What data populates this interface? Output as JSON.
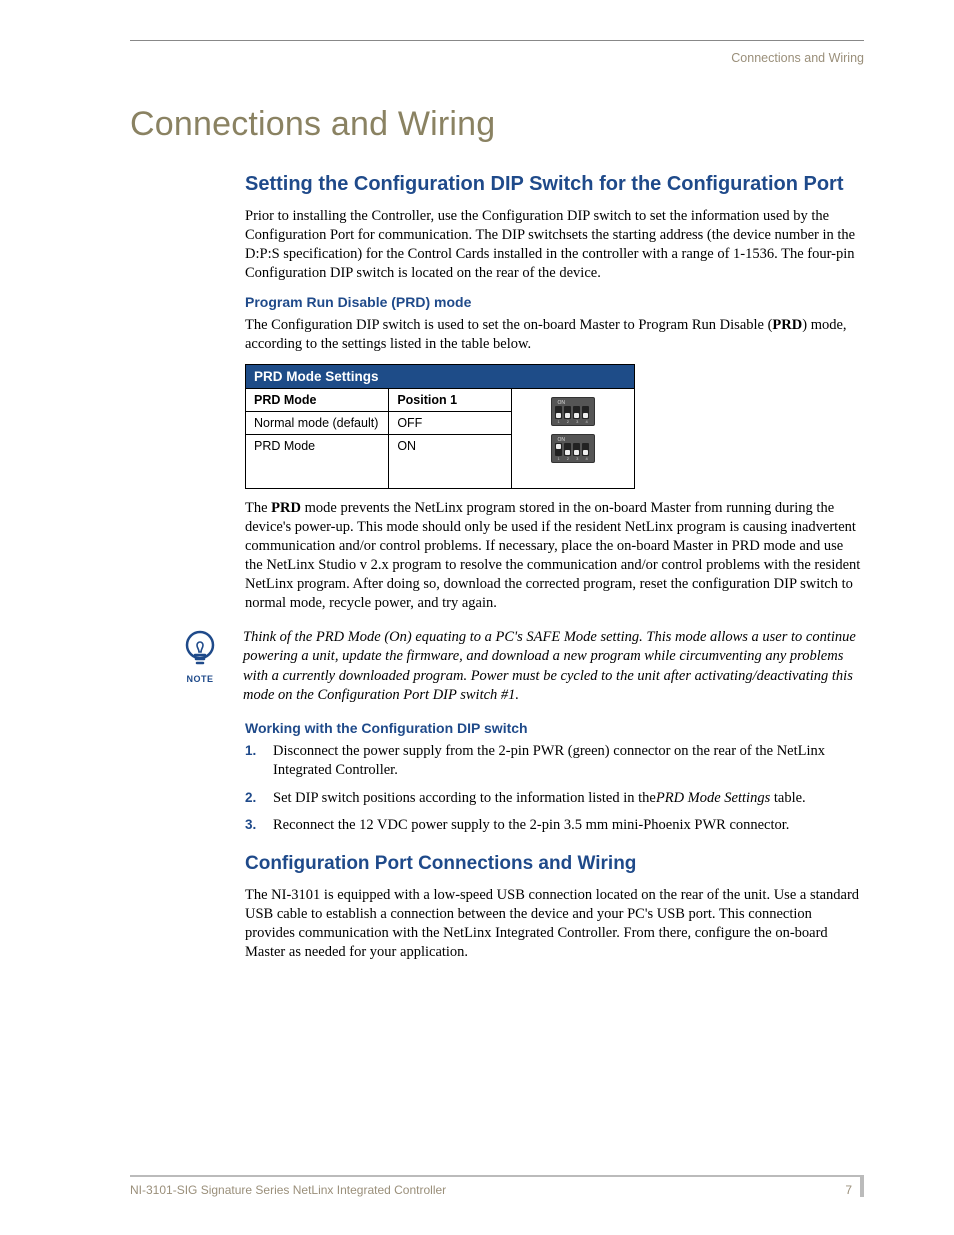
{
  "header": {
    "running_head": "Connections and Wiring"
  },
  "h1": "Connections and Wiring",
  "section1": {
    "title": "Setting the Configuration DIP Switch for the Configuration Port",
    "intro": "Prior to installing the Controller, use the Configuration DIP switch to set the information used by the Configuration Port for communication. The DIP switchsets the starting address (the device number in the D:P:S specification) for the Control Cards installed in the controller with a range of 1-1536. The four-pin Configuration DIP switch is located on the rear of the device.",
    "sub1": {
      "title": "Program Run Disable (PRD) mode",
      "p1_a": "The Configuration DIP switch is used to set the on-board Master to Program Run Disable (",
      "p1_b": "PRD",
      "p1_c": ") mode, according to the settings listed in the table below.",
      "table": {
        "title": "PRD Mode Settings",
        "col1": "PRD Mode",
        "col2": "Position 1",
        "r1c1": "Normal mode (default)",
        "r1c2": "OFF",
        "r2c1": "PRD Mode",
        "r2c2": "ON"
      },
      "p2_a": "The ",
      "p2_b": "PRD",
      "p2_c": " mode prevents the NetLinx program stored in the on-board Master from running during the device's power-up. This mode should only be used if the resident NetLinx program is causing inadvertent communication and/or control problems. If necessary, place the on-board Master in PRD mode and use the NetLinx Studio v 2.x program to resolve the communication and/or control problems with the resident NetLinx program. After doing so, download the corrected program, reset the configuration DIP switch to normal mode, recycle power, and try again.",
      "note_label": "NOTE",
      "note": "Think of the PRD Mode (On) equating to a PC's SAFE Mode setting. This mode allows a user to continue powering a unit, update the firmware, and download a new program while circumventing any problems with a currently downloaded program. Power must be cycled to the unit after activating/deactivating this mode on the Configuration Port DIP switch #1."
    },
    "sub2": {
      "title": "Working with the Configuration DIP switch",
      "step1": "Disconnect the power supply from the 2-pin PWR (green) connector on the rear of the NetLinx Integrated Controller.",
      "step2_a": "Set DIP switch positions according to the information listed in the",
      "step2_b": "PRD Mode Settings",
      "step2_c": " table.",
      "step3": "Reconnect the 12 VDC power supply to the 2-pin 3.5 mm mini-Phoenix PWR connector."
    }
  },
  "section2": {
    "title": "Configuration Port Connections and Wiring",
    "p": "The NI-3101 is equipped with a low-speed USB connection located on the rear of the unit. Use a standard USB cable to establish a connection between the device and your PC's USB port. This connection provides communication with the NetLinx Integrated Controller. From there, configure the on-board Master as needed for your application."
  },
  "footer": {
    "left": "NI-3101-SIG Signature Series NetLinx Integrated Controller",
    "page": "7"
  },
  "dip": {
    "on_label": "ON",
    "nums": "1 2 3 4"
  }
}
